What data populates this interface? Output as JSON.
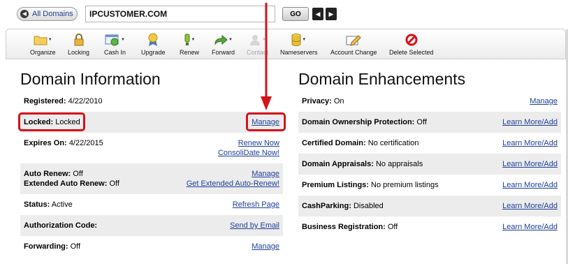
{
  "topbar": {
    "all_domains_label": "All Domains",
    "domain_value": "IPCUSTOMER.COM",
    "go_label": "GO"
  },
  "toolbar": {
    "items": [
      {
        "label": "Organize",
        "icon": "folder-icon"
      },
      {
        "label": "Locking",
        "icon": "lock-icon"
      },
      {
        "label": "Cash In",
        "icon": "cash-in-icon"
      },
      {
        "label": "Upgrade",
        "icon": "ribbon-icon"
      },
      {
        "label": "Renew",
        "icon": "renew-icon"
      },
      {
        "label": "Forward",
        "icon": "forward-arrow-icon"
      },
      {
        "label": "Contact",
        "icon": "contact-icon"
      },
      {
        "label": "Nameservers",
        "icon": "database-icon"
      },
      {
        "label": "Account Change",
        "icon": "edit-pencil-icon"
      },
      {
        "label": "Delete Selected",
        "icon": "delete-icon"
      }
    ]
  },
  "domain_info": {
    "title": "Domain Information",
    "registered": {
      "label": "Registered:",
      "value": "4/22/2010"
    },
    "locked": {
      "label": "Locked:",
      "value": "Locked",
      "link": "Manage"
    },
    "expires": {
      "label": "Expires On:",
      "value": "4/22/2015",
      "link1": "Renew Now",
      "link2": "ConsoliDate Now!"
    },
    "auto_renew": {
      "label": "Auto Renew:",
      "value": "Off",
      "link": "Manage"
    },
    "ext_auto_renew": {
      "label": "Extended Auto Renew:",
      "value": "Off",
      "link": "Get Extended Auto-Renew!"
    },
    "status": {
      "label": "Status:",
      "value": "Active",
      "link": "Refresh Page"
    },
    "auth_code": {
      "label": "Authorization Code:",
      "link": "Send by Email"
    },
    "forwarding": {
      "label": "Forwarding:",
      "value": "Off",
      "link": "Manage"
    }
  },
  "enhancements": {
    "title": "Domain Enhancements",
    "rows": [
      {
        "label": "Privacy:",
        "value": "On",
        "link": "Manage"
      },
      {
        "label": "Domain Ownership Protection:",
        "value": "Off",
        "link": "Learn More/Add"
      },
      {
        "label": "Certified Domain:",
        "value": "No certification",
        "link": "Learn More/Add"
      },
      {
        "label": "Domain Appraisals:",
        "value": "No appraisals",
        "link": "Learn More/Add"
      },
      {
        "label": "Premium Listings:",
        "value": "No premium listings",
        "link": "Learn More/Add"
      },
      {
        "label": "CashParking:",
        "value": "Disabled",
        "link": "Learn More/Add"
      },
      {
        "label": "Business Registration:",
        "value": "Off",
        "link": "Learn More/Add"
      }
    ]
  },
  "colors": {
    "highlight": "#d4121a",
    "link": "#1f3f9a",
    "row_shade": "#ececec"
  }
}
